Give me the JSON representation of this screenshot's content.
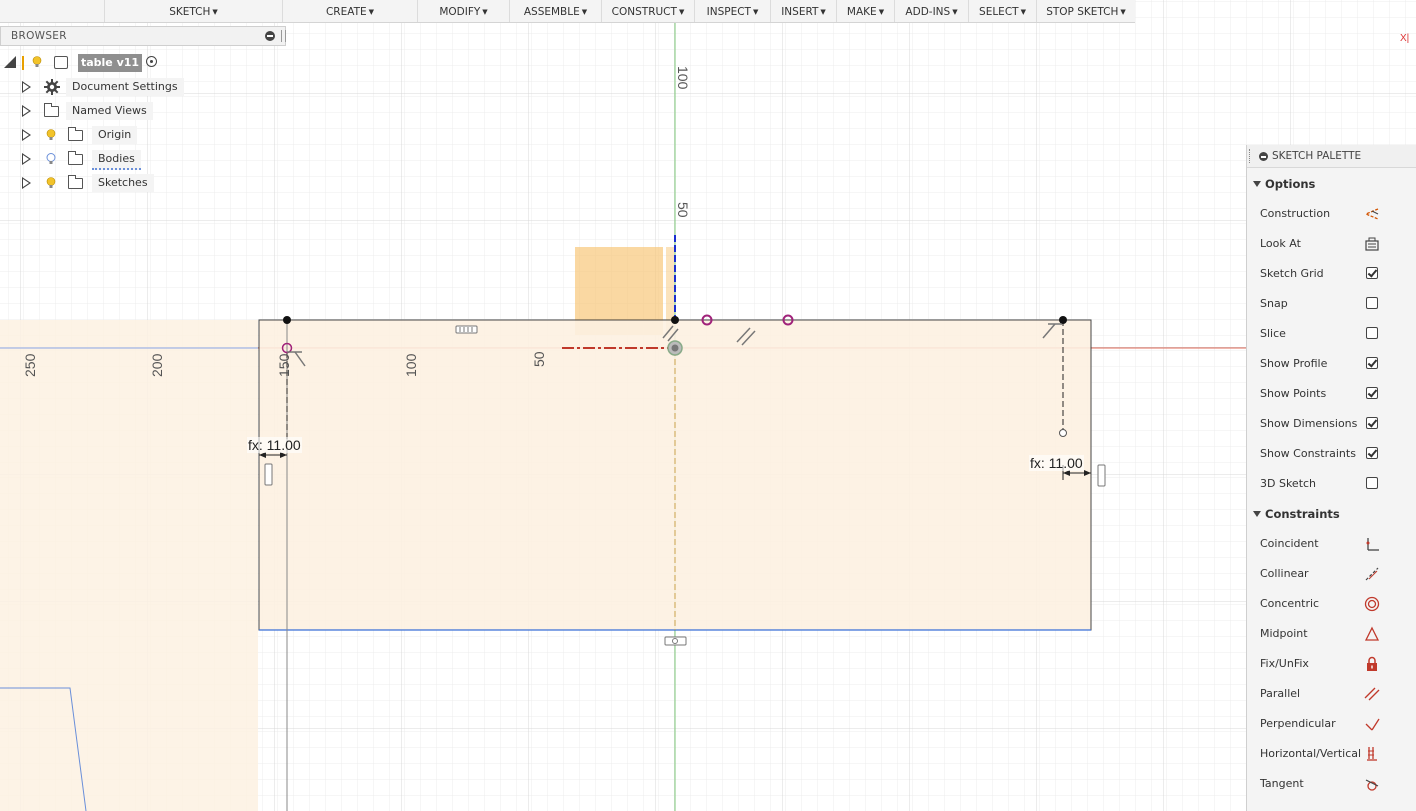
{
  "toolbar": {
    "menus": [
      {
        "label": "SKETCH"
      },
      {
        "label": "CREATE"
      },
      {
        "label": "MODIFY"
      },
      {
        "label": "ASSEMBLE"
      },
      {
        "label": "CONSTRUCT"
      },
      {
        "label": "INSPECT"
      },
      {
        "label": "INSERT"
      },
      {
        "label": "MAKE"
      },
      {
        "label": "ADD-INS"
      },
      {
        "label": "SELECT"
      },
      {
        "label": "STOP SKETCH"
      }
    ]
  },
  "browser": {
    "title": "BROWSER",
    "root": {
      "label": "table v11"
    },
    "items": [
      {
        "label": "Document Settings",
        "icon": "gear-icon"
      },
      {
        "label": "Named Views",
        "icon": "folder-icon"
      },
      {
        "label": "Origin",
        "icon": "folder-icon",
        "visible": true
      },
      {
        "label": "Bodies",
        "icon": "folder-icon",
        "visible": false
      },
      {
        "label": "Sketches",
        "icon": "folder-icon",
        "visible": true
      }
    ]
  },
  "canvas": {
    "x_axis_labels": [
      "250",
      "200",
      "150",
      "100",
      "50"
    ],
    "y_axis_labels": [
      "100",
      "50"
    ],
    "dimensions": [
      "fx: 11.00",
      "fx: 11.00"
    ],
    "colors": {
      "profile_fill": "#fdf1e2",
      "x_axis": "#e06b5a",
      "y_axis": "#7ec77a",
      "constraint": "#a0227a",
      "highlight": "#f8c87a"
    }
  },
  "palette": {
    "title": "SKETCH PALETTE",
    "options_header": "Options",
    "options": [
      {
        "label": "Construction",
        "type": "icon",
        "icon": "construction-icon"
      },
      {
        "label": "Look At",
        "type": "icon",
        "icon": "look-at-icon"
      },
      {
        "label": "Sketch Grid",
        "type": "checkbox",
        "checked": true
      },
      {
        "label": "Snap",
        "type": "checkbox",
        "checked": false
      },
      {
        "label": "Slice",
        "type": "checkbox",
        "checked": false
      },
      {
        "label": "Show Profile",
        "type": "checkbox",
        "checked": true
      },
      {
        "label": "Show Points",
        "type": "checkbox",
        "checked": true
      },
      {
        "label": "Show Dimensions",
        "type": "checkbox",
        "checked": true
      },
      {
        "label": "Show Constraints",
        "type": "checkbox",
        "checked": true
      },
      {
        "label": "3D Sketch",
        "type": "checkbox",
        "checked": false
      }
    ],
    "constraints_header": "Constraints",
    "constraints": [
      {
        "label": "Coincident",
        "icon": "coincident-icon"
      },
      {
        "label": "Collinear",
        "icon": "collinear-icon"
      },
      {
        "label": "Concentric",
        "icon": "concentric-icon"
      },
      {
        "label": "Midpoint",
        "icon": "midpoint-icon"
      },
      {
        "label": "Fix/UnFix",
        "icon": "lock-icon"
      },
      {
        "label": "Parallel",
        "icon": "parallel-icon"
      },
      {
        "label": "Perpendicular",
        "icon": "perpendicular-icon"
      },
      {
        "label": "Horizontal/Vertical",
        "icon": "horizontal-vertical-icon"
      },
      {
        "label": "Tangent",
        "icon": "tangent-icon"
      }
    ]
  }
}
